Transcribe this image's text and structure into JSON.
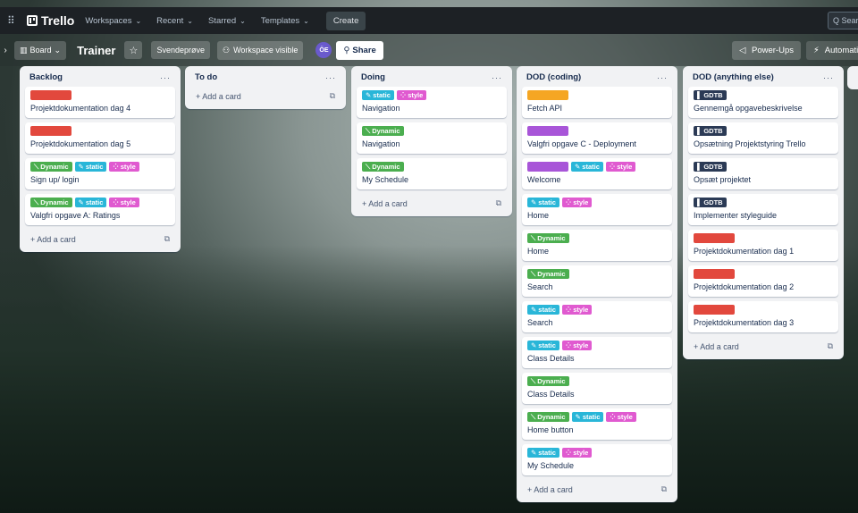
{
  "topbar": {
    "logo": "Trello",
    "nav": [
      {
        "label": "Workspaces"
      },
      {
        "label": "Recent"
      },
      {
        "label": "Starred"
      },
      {
        "label": "Templates"
      }
    ],
    "create": "Create",
    "search": "Q  Search"
  },
  "boardbar": {
    "view": "Board",
    "title": "Trainer",
    "workspace": "Svendeprøve",
    "visibility": "Workspace visible",
    "avatar": "ÖE",
    "share": "Share",
    "powerups": "Power-Ups",
    "automation": "Automation"
  },
  "colors": {
    "red": "#e2483d",
    "orange": "#f5a623",
    "purple": "#a855d8",
    "green": "#4bae4f",
    "blue": "#29b6d8",
    "pink": "#e05ad0",
    "gdtb": "#2b3a55"
  },
  "lists": [
    {
      "title": "Backlog",
      "menu": "···",
      "add": "+ Add a card",
      "cards": [
        {
          "labels": [
            {
              "color": "red",
              "text": ""
            }
          ],
          "title": "Projektdokumentation dag 4"
        },
        {
          "labels": [
            {
              "color": "red",
              "text": ""
            }
          ],
          "title": "Projektdokumentation dag 5"
        },
        {
          "labels": [
            {
              "color": "green",
              "text": "Dynamic"
            },
            {
              "color": "blue",
              "text": "static"
            },
            {
              "color": "pink",
              "text": "style"
            }
          ],
          "title": "Sign up/ login"
        },
        {
          "labels": [
            {
              "color": "green",
              "text": "Dynamic"
            },
            {
              "color": "blue",
              "text": "static"
            },
            {
              "color": "pink",
              "text": "style"
            }
          ],
          "title": "Valgfri opgave A: Ratings"
        }
      ]
    },
    {
      "title": "To do",
      "menu": "···",
      "add": "+ Add a card",
      "cards": []
    },
    {
      "title": "Doing",
      "menu": "···",
      "add": "+ Add a card",
      "cards": [
        {
          "labels": [
            {
              "color": "blue",
              "text": "static"
            },
            {
              "color": "pink",
              "text": "style"
            }
          ],
          "title": "Navigation"
        },
        {
          "labels": [
            {
              "color": "green",
              "text": "Dynamic"
            }
          ],
          "title": "Navigation"
        },
        {
          "labels": [
            {
              "color": "green",
              "text": "Dynamic"
            }
          ],
          "title": "My Schedule"
        }
      ]
    },
    {
      "title": "DOD (coding)",
      "menu": "···",
      "add": "+ Add a card",
      "cards": [
        {
          "labels": [
            {
              "color": "orange",
              "text": ""
            }
          ],
          "title": "Fetch API"
        },
        {
          "labels": [
            {
              "color": "purple",
              "text": ""
            }
          ],
          "title": "Valgfri opgave C - Deployment"
        },
        {
          "labels": [
            {
              "color": "purple",
              "text": ""
            },
            {
              "color": "blue",
              "text": "static"
            },
            {
              "color": "pink",
              "text": "style"
            }
          ],
          "title": "Welcome"
        },
        {
          "labels": [
            {
              "color": "blue",
              "text": "static"
            },
            {
              "color": "pink",
              "text": "style"
            }
          ],
          "title": "Home"
        },
        {
          "labels": [
            {
              "color": "green",
              "text": "Dynamic"
            }
          ],
          "title": "Home"
        },
        {
          "labels": [
            {
              "color": "green",
              "text": "Dynamic"
            }
          ],
          "title": "Search"
        },
        {
          "labels": [
            {
              "color": "blue",
              "text": "static"
            },
            {
              "color": "pink",
              "text": "style"
            }
          ],
          "title": "Search"
        },
        {
          "labels": [
            {
              "color": "blue",
              "text": "static"
            },
            {
              "color": "pink",
              "text": "style"
            }
          ],
          "title": "Class Details"
        },
        {
          "labels": [
            {
              "color": "green",
              "text": "Dynamic"
            }
          ],
          "title": "Class Details"
        },
        {
          "labels": [
            {
              "color": "green",
              "text": "Dynamic"
            },
            {
              "color": "blue",
              "text": "static"
            },
            {
              "color": "pink",
              "text": "style"
            }
          ],
          "title": "Home button"
        },
        {
          "labels": [
            {
              "color": "blue",
              "text": "static"
            },
            {
              "color": "pink",
              "text": "style"
            }
          ],
          "title": "My Schedule"
        }
      ]
    },
    {
      "title": "DOD (anything else)",
      "menu": "···",
      "add": "+ Add a card",
      "cards": [
        {
          "labels": [
            {
              "color": "gdtb",
              "text": "GDTB"
            }
          ],
          "title": "Gennemgå opgavebeskrivelse"
        },
        {
          "labels": [
            {
              "color": "gdtb",
              "text": "GDTB"
            }
          ],
          "title": "Opsætning Projektstyring Trello"
        },
        {
          "labels": [
            {
              "color": "gdtb",
              "text": "GDTB"
            }
          ],
          "title": "Opsæt projektet"
        },
        {
          "labels": [
            {
              "color": "gdtb",
              "text": "GDTB"
            }
          ],
          "title": "Implementer styleguide"
        },
        {
          "labels": [
            {
              "color": "red",
              "text": ""
            }
          ],
          "title": "Projektdokumentation dag 1"
        },
        {
          "labels": [
            {
              "color": "red",
              "text": ""
            }
          ],
          "title": "Projektdokumentation dag 2"
        },
        {
          "labels": [
            {
              "color": "red",
              "text": ""
            }
          ],
          "title": "Projektdokumentation dag 3"
        }
      ]
    }
  ]
}
